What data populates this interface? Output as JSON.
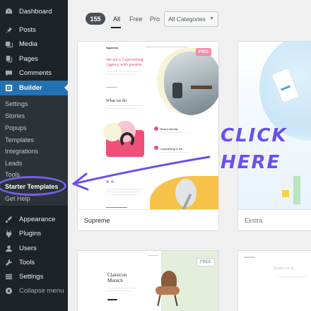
{
  "sidebar": {
    "top_items": [
      {
        "label": "Dashboard",
        "icon": "dashboard-icon"
      },
      {
        "label": "Posts",
        "icon": "pin-icon"
      },
      {
        "label": "Media",
        "icon": "media-icon"
      },
      {
        "label": "Pages",
        "icon": "pages-icon"
      },
      {
        "label": "Comments",
        "icon": "comment-icon"
      },
      {
        "label": "Builder",
        "icon": "builder-icon"
      }
    ],
    "submenu": [
      "Settings",
      "Stories",
      "Popups",
      "Templates",
      "Integrations",
      "Leads",
      "Tools",
      "Starter Templates",
      "Get Help"
    ],
    "bottom_items": [
      {
        "label": "Appearance",
        "icon": "brush-icon"
      },
      {
        "label": "Plugins",
        "icon": "plugin-icon"
      },
      {
        "label": "Users",
        "icon": "user-icon"
      },
      {
        "label": "Tools",
        "icon": "wrench-icon"
      },
      {
        "label": "Settings",
        "icon": "settings-icon"
      },
      {
        "label": "Collapse menu",
        "icon": "collapse-icon"
      }
    ],
    "active_color": "#2271b1"
  },
  "filters": {
    "count": "155",
    "tabs": [
      "All",
      "Free",
      "Pro"
    ],
    "category_select": "All Categories"
  },
  "cards": [
    {
      "name": "Supreme",
      "badge": "PRO",
      "preview": {
        "brand": "Supreme",
        "headline_1": "We are a Copywriting",
        "headline_2": "Agency with passion",
        "section": "What we do",
        "service_1": "Brand Identity",
        "service_2": "Copywriting & Ink"
      }
    },
    {
      "name": "Ekstra"
    },
    {
      "badge": "FREE",
      "preview": {
        "headline_1": "Classicon",
        "headline_2": "Munich"
      }
    },
    {
      "preview": {
        "tagline": "Dealer jvly b..."
      }
    }
  ],
  "annotation": {
    "line_1": "CLICK",
    "line_2": "HERE",
    "color": "#6b4ff0"
  }
}
